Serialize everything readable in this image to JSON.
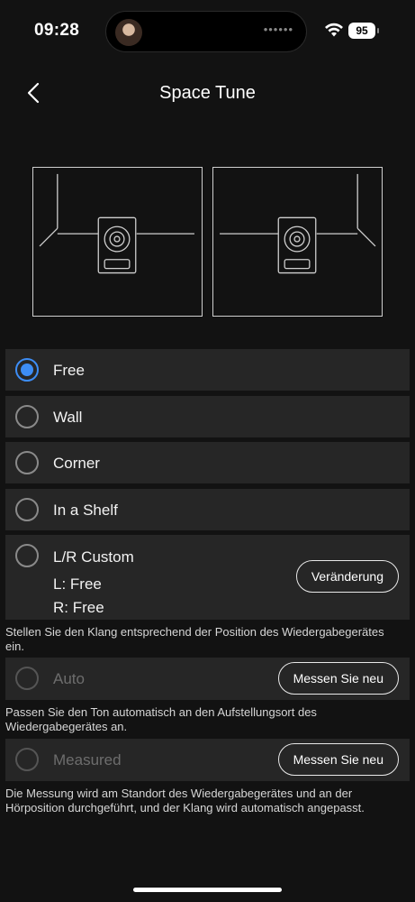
{
  "status_bar": {
    "time": "09:28",
    "island_dots": "••••••",
    "battery": "95"
  },
  "header": {
    "title": "Space Tune"
  },
  "options": [
    {
      "label": "Free",
      "selected": true
    },
    {
      "label": "Wall",
      "selected": false
    },
    {
      "label": "Corner",
      "selected": false
    },
    {
      "label": "In a Shelf",
      "selected": false
    },
    {
      "label": "L/R Custom",
      "selected": false,
      "left_value": "L: Free",
      "right_value": "R: Free",
      "button": "Veränderung"
    }
  ],
  "desc_position": "Stellen Sie den Klang entsprechend der Position des Wiedergabegerätes ein.",
  "auto": {
    "label": "Auto",
    "button": "Messen Sie neu",
    "desc": "Passen Sie den Ton automatisch an den Aufstellungsort des Wiedergabegerätes an."
  },
  "measured": {
    "label": "Measured",
    "button": "Messen Sie neu",
    "desc": "Die Messung wird am Standort des Wiedergabegerätes und an der Hörposition durchgeführt, und der Klang wird automatisch angepasst."
  },
  "colors": {
    "accent": "#3d8df5",
    "background": "#121212",
    "card": "#262626"
  },
  "icons": {
    "back": "chevron-left-icon",
    "wifi": "wifi-icon",
    "battery": "battery-icon"
  }
}
